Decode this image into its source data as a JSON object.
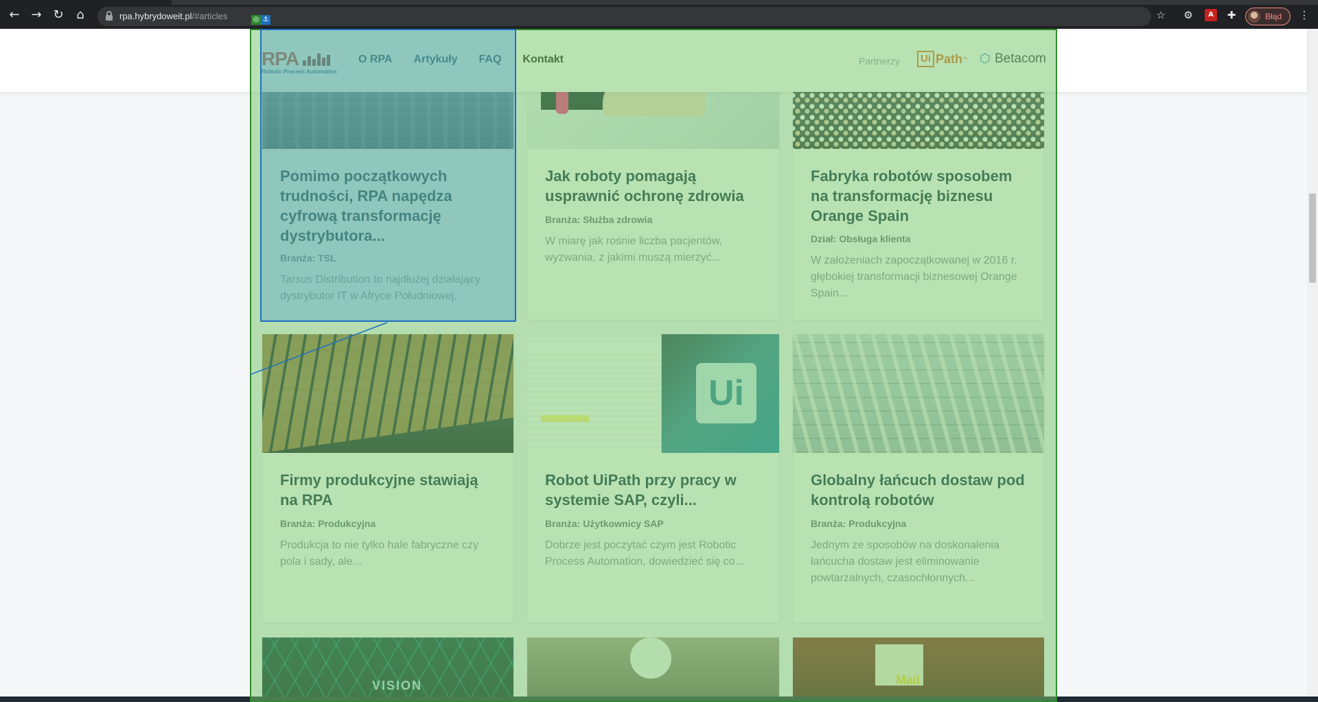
{
  "browser": {
    "url_host": "rpa.hybrydoweit.pl",
    "url_path": "/#articles",
    "profile_label": "Błąd",
    "icons": [
      "back-icon",
      "forward-icon",
      "reload-icon",
      "home-icon",
      "lock-icon",
      "star-icon",
      "gear-icon",
      "pdf-icon",
      "puzzle-icon",
      "menu-icon"
    ]
  },
  "header": {
    "logo_text": "RPA",
    "logo_sub": "Robotic Process Automation",
    "menu": [
      "O RPA",
      "Artykuły",
      "FAQ",
      "Kontakt"
    ],
    "partners_label": "Partnerzy",
    "partner_uipath_ui": "Ui",
    "partner_uipath_path": "Path",
    "partner_uipath_tm": "™",
    "partner_betacom": "Betacom"
  },
  "articles": [
    {
      "title": "Pomimo początkowych trudności, RPA napędza cyfrową transformację dystrybutora...",
      "meta": "Branża: TSL",
      "excerpt": "Tarsus Distribution to najdłużej działający dystrybutor IT w Afryce Południowej."
    },
    {
      "title": "Jak roboty pomagają usprawnić ochronę zdrowia",
      "meta": "Branża: Służba zdrowia",
      "excerpt": "W miarę jak rośnie liczba pacjentów, wyzwania, z jakimi muszą mierzyć..."
    },
    {
      "title": "Fabryka robotów sposobem na transformację biznesu Orange Spain",
      "meta": "Dział: Obsługa klienta",
      "excerpt": "W założeniach zapoczątkowanej w 2016 r. głębokiej transformacji biznesowej Orange Spain..."
    },
    {
      "title": "Firmy produkcyjne stawiają na RPA",
      "meta": "Branża: Produkcyjna",
      "excerpt": "Produkcja to nie tylko hale fabryczne czy pola i sady, ale..."
    },
    {
      "title": "Robot UiPath przy pracy w systemie SAP, czyli...",
      "meta": "Branża: Użytkownicy SAP",
      "excerpt": "Dobrze jest poczytać czym jest Robotic Process Automation, dowiedzieć się co..."
    },
    {
      "title": "Globalny łańcuch dostaw pod kontrolą robotów",
      "meta": "Branża: Produkcyjna",
      "excerpt": "Jednym ze sposobów na doskonalenia łańcucha dostaw jest eliminowanie powtarzalnych, czasochłonnych..."
    }
  ],
  "images": {
    "sap_tile": "Ui",
    "vision_label": "VISION",
    "mail_sign": "Mail"
  },
  "colors": {
    "chrome_bg": "#202124",
    "title": "#0b2a3c",
    "overlay_green": "#78c86e",
    "overlay_blue": "#4696d2",
    "uipath": "#e26b21",
    "betacom": "#2a7bbf"
  }
}
